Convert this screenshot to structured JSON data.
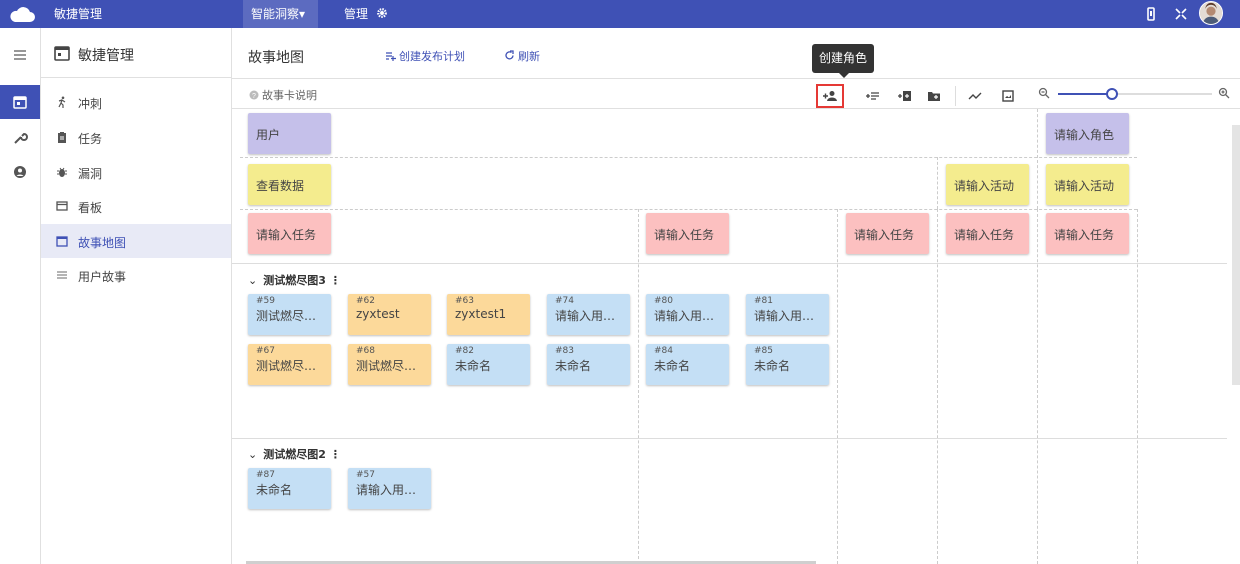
{
  "topbar": {
    "app_title": "敏捷管理",
    "menu_insight": "智能洞察▾",
    "menu_admin": "管理"
  },
  "sidebar": {
    "title": "敏捷管理",
    "items": [
      {
        "label": "冲刺",
        "icon": "run-icon"
      },
      {
        "label": "任务",
        "icon": "clipboard-icon"
      },
      {
        "label": "漏洞",
        "icon": "bug-icon"
      },
      {
        "label": "看板",
        "icon": "board-icon"
      },
      {
        "label": "故事地图",
        "icon": "calendar-icon",
        "active": true
      },
      {
        "label": "用户故事",
        "icon": "list-icon"
      }
    ]
  },
  "header": {
    "title": "故事地图",
    "create_plan": "创建发布计划",
    "refresh": "刷新"
  },
  "toolbar": {
    "legend": "故事卡说明",
    "tooltip": "创建角色",
    "zoom_level": 0.35
  },
  "map": {
    "roles": [
      "用户",
      "请输入角色"
    ],
    "activities": [
      "查看数据",
      "请输入活动",
      "请输入活动"
    ],
    "tasks": [
      "请输入任务",
      "请输入任务",
      "请输入任务",
      "请输入任务",
      "请输入任务"
    ]
  },
  "sprints": [
    {
      "name": "测试燃尽图3",
      "cards": [
        {
          "num": "#59",
          "text": "测试燃尽图..."
        },
        {
          "num": "#62",
          "text": "zyxtest"
        },
        {
          "num": "#63",
          "text": "zyxtest1"
        },
        {
          "num": "#74",
          "text": "请输入用户..."
        },
        {
          "num": "#80",
          "text": "请输入用户..."
        },
        {
          "num": "#81",
          "text": "请输入用户..."
        },
        {
          "num": "#67",
          "text": "测试燃尽图..."
        },
        {
          "num": "#68",
          "text": "测试燃尽图..."
        },
        {
          "num": "#82",
          "text": "未命名"
        },
        {
          "num": "#83",
          "text": "未命名"
        },
        {
          "num": "#84",
          "text": "未命名"
        },
        {
          "num": "#85",
          "text": "未命名"
        }
      ]
    },
    {
      "name": "测试燃尽图2",
      "cards": [
        {
          "num": "#87",
          "text": "未命名"
        },
        {
          "num": "#57",
          "text": "请输入用户..."
        }
      ]
    }
  ],
  "colors": {
    "primary": "#3f51b5",
    "role": "#c5c0ea",
    "activity": "#f4ec8e",
    "task": "#fcc0c0",
    "story": "#c4dff5",
    "story_alt": "#fcd99a",
    "highlight": "#e53935"
  }
}
